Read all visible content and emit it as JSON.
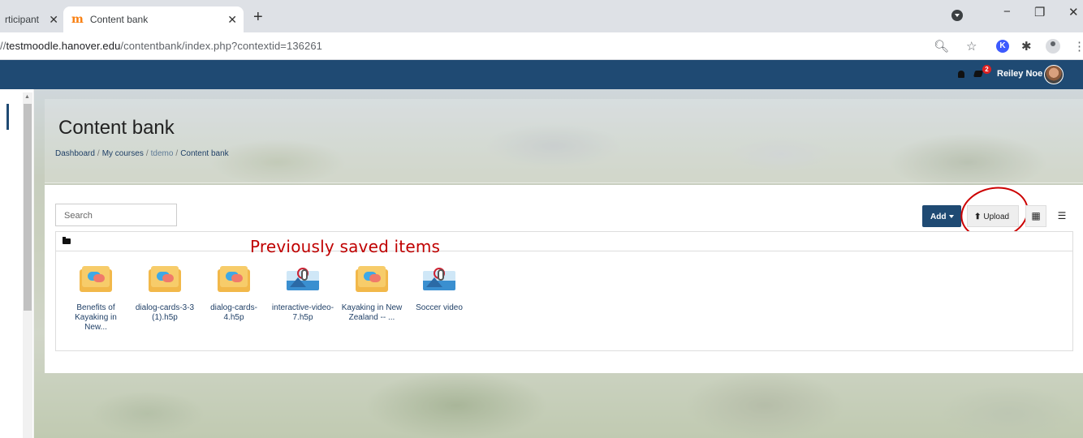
{
  "browser": {
    "tabs": [
      {
        "label": "rticipant"
      },
      {
        "label": "Content bank"
      }
    ],
    "new_tab": "+",
    "url_prefix": "//",
    "url_host": "testmoodle.hanover.edu",
    "url_path": "/contentbank/index.php?contextid=136261"
  },
  "navbar": {
    "notification_count": "2",
    "user_name": "Reiley Noe"
  },
  "page": {
    "title": "Content bank",
    "breadcrumb": [
      "Dashboard",
      "My courses",
      "tdemo",
      "Content bank"
    ],
    "breadcrumb_sep": "/"
  },
  "toolbar": {
    "search_placeholder": "Search",
    "add_label": "Add",
    "upload_label": "Upload"
  },
  "annotation": "Previously saved items",
  "items": [
    {
      "label": "Benefits of Kayaking in New...",
      "type": "dialog-cards"
    },
    {
      "label": "dialog-cards-3-3 (1).h5p",
      "type": "dialog-cards"
    },
    {
      "label": "dialog-cards-4.h5p",
      "type": "dialog-cards"
    },
    {
      "label": "interactive-video-7.h5p",
      "type": "interactive-video"
    },
    {
      "label": "Kayaking in New Zealand -- ...",
      "type": "dialog-cards"
    },
    {
      "label": "Soccer video",
      "type": "interactive-video"
    }
  ],
  "colors": {
    "navbar": "#1f4a73",
    "annotation": "#c00000",
    "link": "#1f3f66"
  }
}
